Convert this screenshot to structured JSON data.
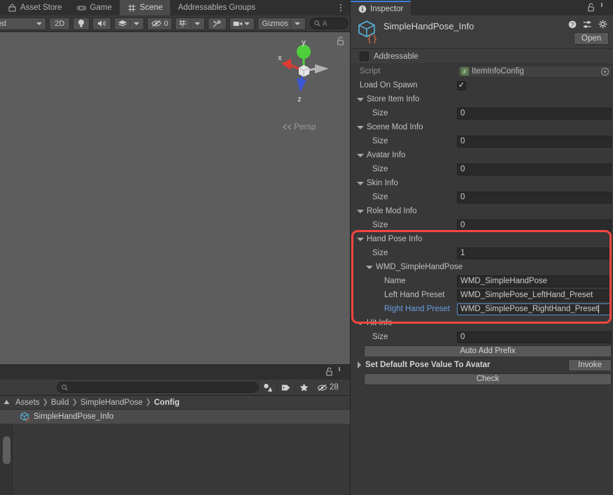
{
  "scene_panel": {
    "tabs": [
      {
        "label": "Asset Store",
        "icon": "store-icon",
        "active": false
      },
      {
        "label": "Game",
        "icon": "gamepad-icon",
        "active": false
      },
      {
        "label": "Scene",
        "icon": "grid-icon",
        "active": true
      },
      {
        "label": "Addressables Groups",
        "icon": "none",
        "active": false
      }
    ],
    "toolbar": {
      "draw_mode": "Shaded",
      "two_d": "2D",
      "lighting_icon": "lightbulb-icon",
      "audio_icon": "speaker-icon",
      "fx_icon": "layers-icon",
      "hidden_objects_count": "0",
      "grid_icon": "grid-snap-icon",
      "tools_icon": "tools-icon",
      "camera_icon": "camera-icon",
      "gizmos_label": "Gizmos",
      "search_placeholder": "A"
    },
    "gizmo": {
      "axis_x": "x",
      "axis_y": "y",
      "axis_z": "z",
      "projection": "Persp",
      "colors": {
        "x": "#dd3b34",
        "y": "#4ecf3c",
        "z": "#3a57d6",
        "neutral": "#c9c9c9"
      }
    }
  },
  "project_panel": {
    "search_placeholder": "",
    "hidden_count": "28",
    "toolbar_icons": [
      "asset-filter-icon",
      "label-filter-icon",
      "favorites-star-icon",
      "hidden-eye-icon"
    ],
    "breadcrumb": [
      "Assets",
      "Build",
      "SimpleHandPose",
      "Config"
    ],
    "assets": [
      {
        "name": "SimpleHandPose_Info",
        "icon": "scriptable-object-icon",
        "selected": true
      }
    ]
  },
  "inspector": {
    "tab_label": "Inspector",
    "tab_icon": "info-icon",
    "lock_icon": "lock-open-icon",
    "kebab_icon": "kebab-menu-icon",
    "asset_name": "SimpleHandPose_Info",
    "asset_icon": "scriptable-object-icon",
    "header_icons": [
      "help-icon",
      "preset-icon",
      "gear-icon"
    ],
    "open_button": "Open",
    "addressable_label": "Addressable",
    "addressable_checked": false,
    "rows": [
      {
        "kind": "prop-readonly",
        "label": "Script",
        "value": "ItemInfoConfig",
        "indent": 13,
        "badge": "script-icon",
        "picker": true,
        "label_dim": true
      },
      {
        "kind": "toggle",
        "label": "Load On Spawn",
        "checked": true,
        "indent": 13
      },
      {
        "kind": "foldout",
        "label": "Store Item Info",
        "open": true,
        "indent": 9
      },
      {
        "kind": "prop",
        "label": "Size",
        "value": "0",
        "indent": 31
      },
      {
        "kind": "foldout",
        "label": "Scene Mod Info",
        "open": true,
        "indent": 9
      },
      {
        "kind": "prop",
        "label": "Size",
        "value": "0",
        "indent": 31
      },
      {
        "kind": "foldout",
        "label": "Avatar Info",
        "open": true,
        "indent": 9
      },
      {
        "kind": "prop",
        "label": "Size",
        "value": "0",
        "indent": 31
      },
      {
        "kind": "foldout",
        "label": "Skin Info",
        "open": true,
        "indent": 9
      },
      {
        "kind": "prop",
        "label": "Size",
        "value": "0",
        "indent": 31
      },
      {
        "kind": "foldout",
        "label": "Role Mod Info",
        "open": true,
        "indent": 9
      },
      {
        "kind": "prop",
        "label": "Size",
        "value": "0",
        "indent": 31
      },
      {
        "kind": "foldout",
        "label": "Hand Pose Info",
        "open": true,
        "indent": 9
      },
      {
        "kind": "prop",
        "label": "Size",
        "value": "1",
        "indent": 31
      },
      {
        "kind": "foldout",
        "label": "WMD_SimpleHandPose",
        "open": true,
        "indent": 22
      },
      {
        "kind": "prop",
        "label": "Name",
        "value": "WMD_SimpleHandPose",
        "indent": 48
      },
      {
        "kind": "prop",
        "label": "Left Hand Preset",
        "value": "WMD_SimplePose_LeftHand_Preset",
        "indent": 48
      },
      {
        "kind": "prop-focused",
        "label": "Right Hand Preset",
        "value": "WMD_SimplePose_RightHand_Preset",
        "indent": 48,
        "label_blue": true
      },
      {
        "kind": "foldout",
        "label": "Hit Info",
        "open": true,
        "indent": 9
      },
      {
        "kind": "prop",
        "label": "Size",
        "value": "0",
        "indent": 31
      },
      {
        "kind": "button-wide",
        "label": "Auto Add Prefix"
      },
      {
        "kind": "foldout-invoke",
        "label": "Set Default Pose Value To Avatar",
        "button": "Invoke",
        "indent": 9
      },
      {
        "kind": "button-wide",
        "label": "Check"
      }
    ]
  },
  "annotation": {
    "highlight_color": "#f4473f",
    "highlight_label": "hand-pose-info-highlight"
  }
}
